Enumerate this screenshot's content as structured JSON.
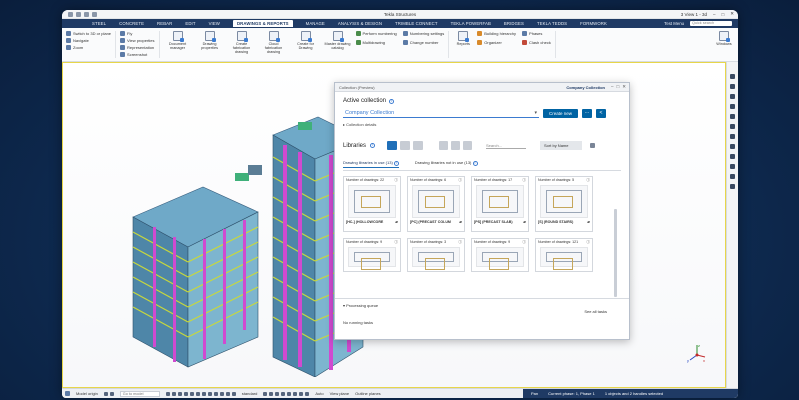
{
  "window": {
    "title": "Tekla Structures",
    "view_title": "3 View 1 - 3d",
    "account": "Test Menu"
  },
  "tabs": [
    {
      "label": "STEEL"
    },
    {
      "label": "CONCRETE"
    },
    {
      "label": "REBAR"
    },
    {
      "label": "EDIT"
    },
    {
      "label": "VIEW"
    },
    {
      "label": "DRAWINGS & REPORTS",
      "active": true
    },
    {
      "label": "MANAGE"
    },
    {
      "label": "ANALYSIS & DESIGN"
    },
    {
      "label": "TRIMBLE CONNECT"
    },
    {
      "label": "TEKLA POWERFAB"
    },
    {
      "label": "BRIDGES"
    },
    {
      "label": "TEKLA TEDDS"
    },
    {
      "label": "FORMWORK"
    }
  ],
  "quick_search": {
    "placeholder": "Quick search"
  },
  "ribbon": {
    "g1": [
      "Switch to 3D or plane",
      "Navigate",
      "Zoom"
    ],
    "g2": [
      "Fly",
      "View properties",
      "Representation",
      "Screenshot"
    ],
    "big": [
      "Document manager",
      "Drawing properties",
      "Create fabrication drawing",
      "Cloud fabrication drawing",
      "Create for Drawing",
      "Master drawing catalog"
    ],
    "g3": [
      "Perform numbering",
      "Multidrawing",
      "Numbering settings",
      "Change number"
    ],
    "g4": [
      "Reports",
      "Building hierarchy",
      "Organizer",
      "Phases",
      "Clash check"
    ],
    "windows": "Windows"
  },
  "dialog": {
    "title": "Collection (Preview)",
    "user": "Company Collection",
    "active_label": "Active collection",
    "active_value": "Company Collection",
    "create_new": "Create new",
    "more": "···",
    "share": "<",
    "details": "Collection details",
    "libraries": "Libraries",
    "search": "Search...",
    "sort": "Sort by Name",
    "tab_in_use": "Drawing libraries in use (13)",
    "tab_not_in_use": "Drawing libraries not in use (13)",
    "cards": [
      {
        "count": "Number of drawings: 22",
        "name": "[HC-] (HOLLOWCORE"
      },
      {
        "count": "Number of drawings: 6",
        "name": "[PC] (PRECAST COLUM"
      },
      {
        "count": "Number of drawings: 17",
        "name": "[PS] (PRECAST SLAB)"
      },
      {
        "count": "Number of drawings: 5",
        "name": "[S] (ROUND STAIRS)"
      },
      {
        "count": "Number of drawings: 9",
        "name": ""
      },
      {
        "count": "Number of drawings: 3",
        "name": ""
      },
      {
        "count": "Number of drawings: 9",
        "name": ""
      },
      {
        "count": "Number of drawings: 121",
        "name": ""
      }
    ],
    "processing": "Processing queue",
    "see_all": "See all tasks",
    "no_tasks": "No running tasks"
  },
  "statusbar": {
    "mode": "Model origin",
    "command": "Go to model",
    "standard": "standard",
    "auto": "Auto",
    "view_plane": "View plane",
    "outline": "Outline planes",
    "pan": "Pan",
    "phase": "Current phase: 1, Phase 1",
    "selection": "1 objects and 2 handles selected"
  },
  "axes": {
    "x": "x",
    "y": "y",
    "z": "z"
  },
  "colors": {
    "accent": "#0063a3",
    "nav": "#1f3a64",
    "viewport_border": "#e7d64a"
  }
}
